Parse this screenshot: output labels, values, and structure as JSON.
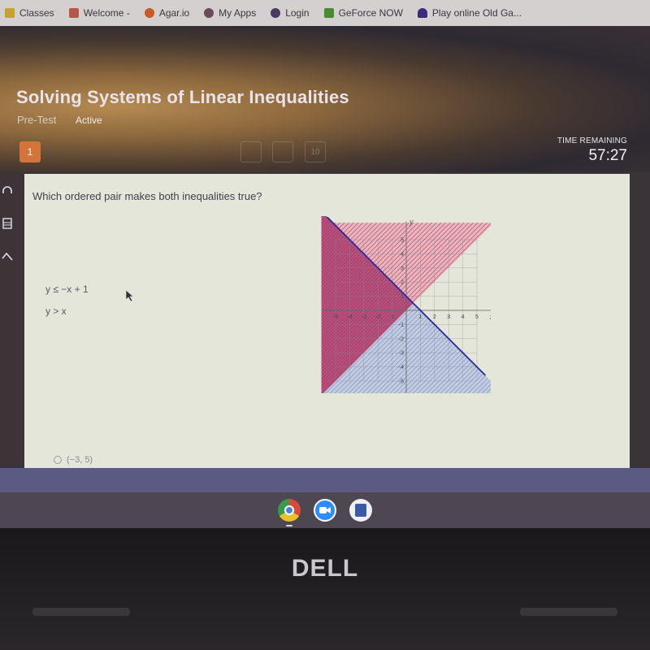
{
  "bookmarks": [
    {
      "label": "Classes",
      "icon": "classroom-icon",
      "color": "#c8a030"
    },
    {
      "label": "Welcome -",
      "icon": "schoology-icon",
      "color": "#b8554a"
    },
    {
      "label": "Agar.io",
      "icon": "agar-icon",
      "color": "#c85a28"
    },
    {
      "label": "My Apps",
      "icon": "apps-icon",
      "color": "#6a4a58"
    },
    {
      "label": "Login",
      "icon": "login-icon",
      "color": "#4a3a60"
    },
    {
      "label": "GeForce NOW",
      "icon": "geforce-icon",
      "color": "#4a8a30"
    },
    {
      "label": "Play online Old Ga...",
      "icon": "ghost-icon",
      "color": "#3a2a80"
    }
  ],
  "lesson": {
    "title": "Solving Systems of Linear Inequalities",
    "type": "Pre-Test",
    "status": "Active"
  },
  "question_nav": {
    "current": "1",
    "faded": [
      "",
      "",
      "10"
    ]
  },
  "timer": {
    "label": "TIME REMAINING",
    "value": "57:27"
  },
  "question": {
    "prompt": "Which ordered pair makes both inequalities true?",
    "inequalities": [
      "y ≤ −x + 1",
      "y > x"
    ],
    "visible_option": "(−3, 5)"
  },
  "graph": {
    "x_label": "x",
    "y_label": "y",
    "x_ticks": [
      "-5",
      "-4",
      "-3",
      "-2",
      "-1",
      "1",
      "2",
      "3",
      "4",
      "5"
    ],
    "y_ticks": [
      "5",
      "4",
      "3",
      "2",
      "1",
      "-1",
      "-2",
      "-3",
      "-4",
      "-5"
    ],
    "colors": {
      "red_region": "#c8506a",
      "blue_region": "#8898c0",
      "boundary_line": "#2a2a9a"
    }
  },
  "shelf": {
    "apps": [
      "chrome-icon",
      "zoom-icon",
      "app-icon"
    ]
  },
  "hardware": {
    "brand": "DELL"
  }
}
